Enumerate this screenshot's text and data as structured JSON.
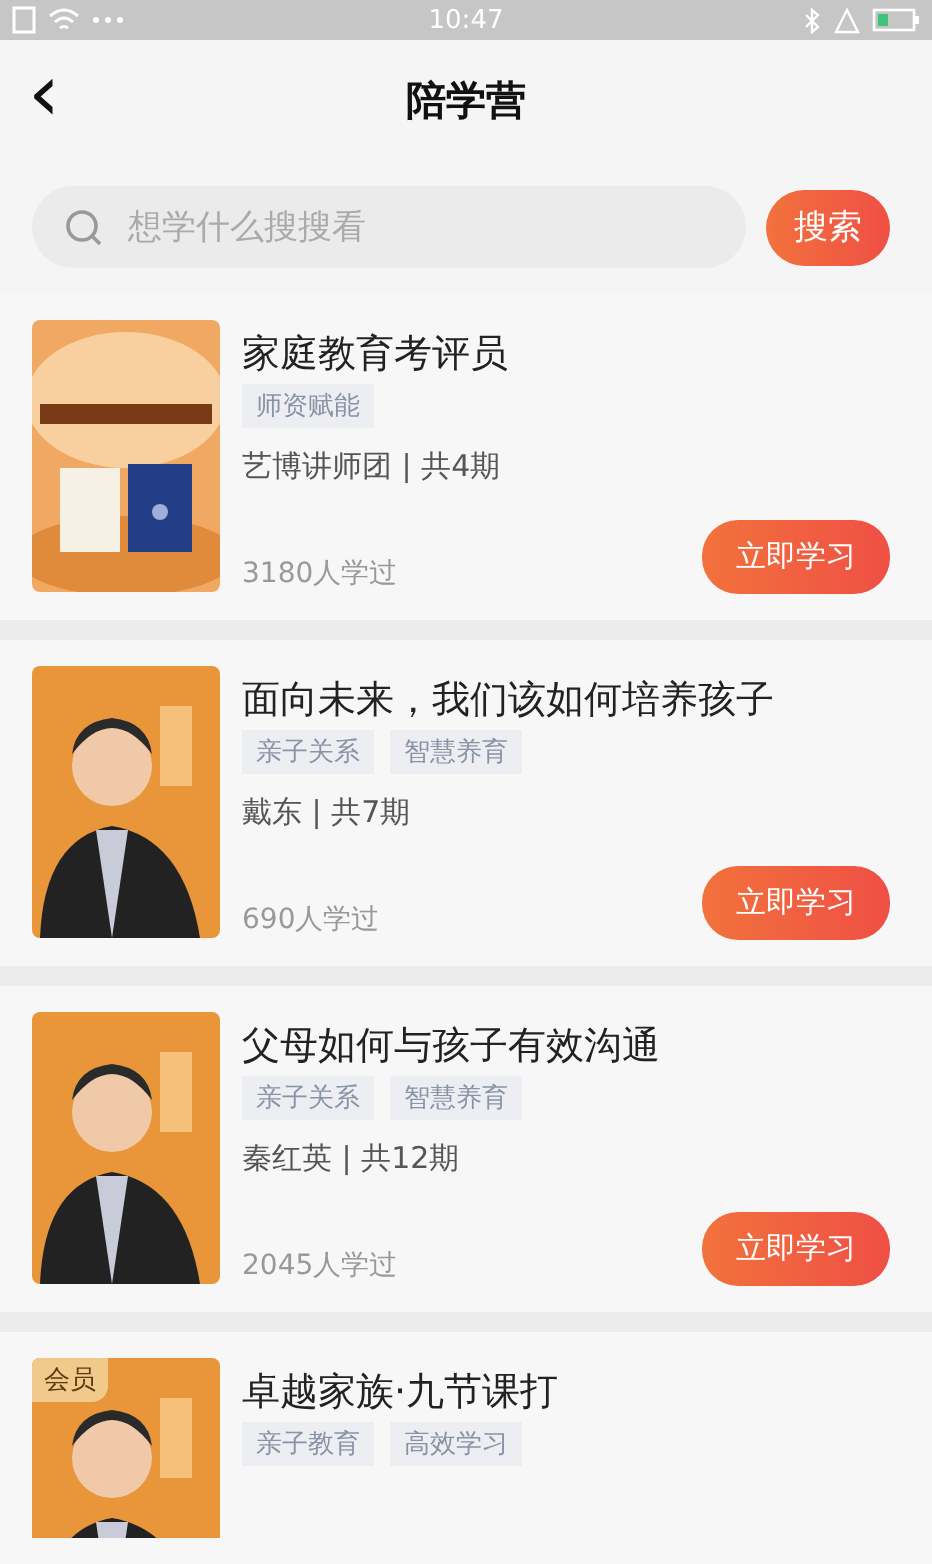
{
  "status_bar": {
    "time": "10:47"
  },
  "header": {
    "back_icon": "‹",
    "title": "陪学营"
  },
  "search": {
    "placeholder": "想学什么搜搜看",
    "button": "搜索"
  },
  "courses": [
    {
      "title": "家庭教育考评员",
      "tags": [
        "师资赋能"
      ],
      "author": "艺博讲师团 | 共4期",
      "learners": "3180人学过",
      "button": "立即学习"
    },
    {
      "title": "面向未来，我们该如何培养孩子",
      "tags": [
        "亲子关系",
        "智慧养育"
      ],
      "author": "戴东 | 共7期",
      "learners": "690人学过",
      "button": "立即学习"
    },
    {
      "title": "父母如何与孩子有效沟通",
      "tags": [
        "亲子关系",
        "智慧养育"
      ],
      "author": "秦红英 | 共12期",
      "learners": "2045人学过",
      "button": "立即学习"
    },
    {
      "title": "卓越家族·九节课打",
      "tags": [
        "亲子教育",
        "高效学习"
      ],
      "badge": "会员"
    }
  ]
}
